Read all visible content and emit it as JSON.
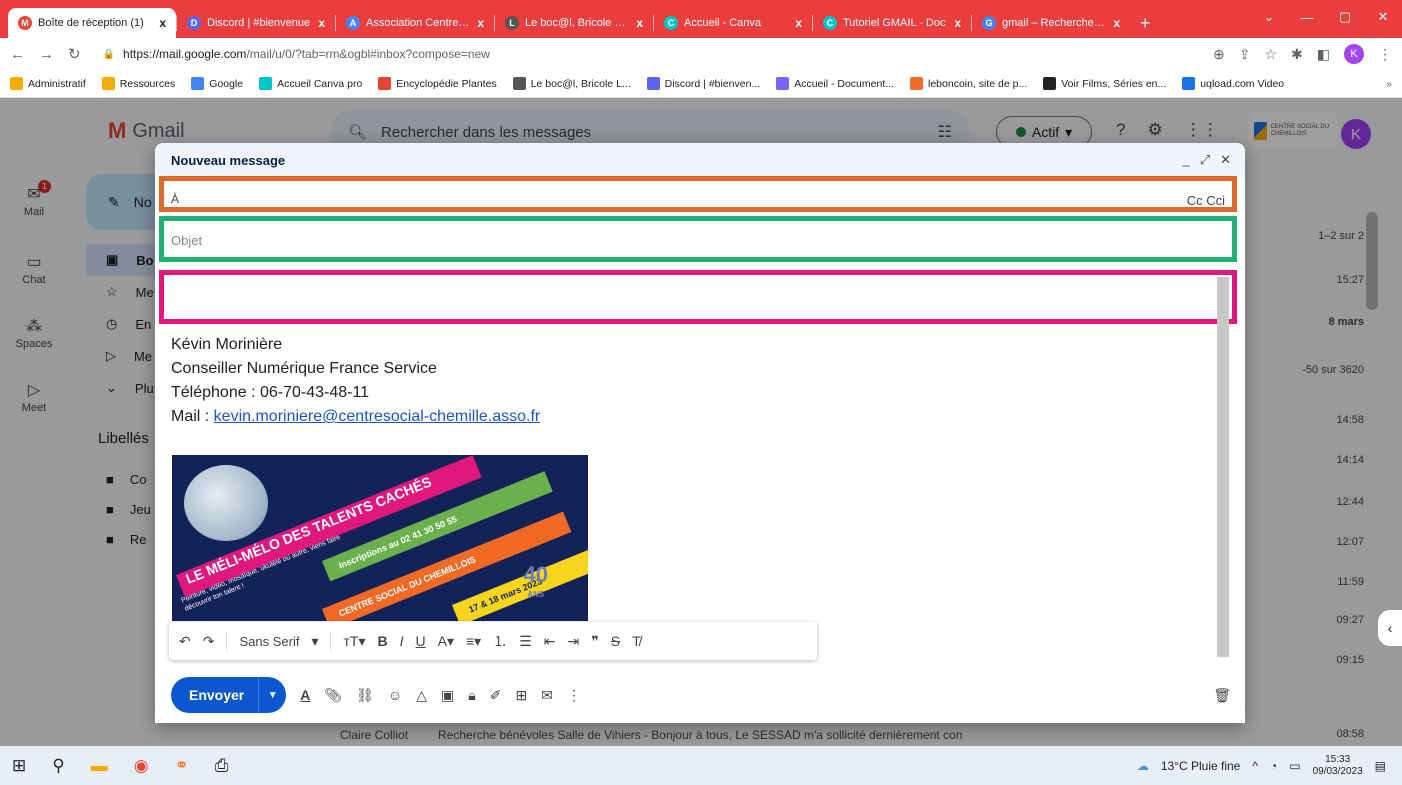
{
  "browser": {
    "tabs": [
      {
        "label": "Boîte de réception (1)",
        "color": "#ea4335",
        "glyph": "M",
        "active": true
      },
      {
        "label": "Discord | #bienvenue",
        "color": "#5865f2",
        "glyph": "D"
      },
      {
        "label": "Association Centre So",
        "color": "#4285f4",
        "glyph": "A"
      },
      {
        "label": "Le boc@l, Bricole Loc",
        "color": "#555555",
        "glyph": "L"
      },
      {
        "label": "Accueil - Canva",
        "color": "#00c4cc",
        "glyph": "C"
      },
      {
        "label": "Tutoriel GMAIL - Doc",
        "color": "#00c4cc",
        "glyph": "C"
      },
      {
        "label": "gmail – Recherche Go",
        "color": "#4285f4",
        "glyph": "G"
      }
    ],
    "tab_close": "x",
    "new_tab": "+",
    "window_controls": [
      "⌄",
      "—",
      "▢",
      "✕"
    ],
    "url_host": "https://mail.google.com",
    "url_rest": "/mail/u/0/?tab=rm&ogbl#inbox?compose=new",
    "profile_initial": "K",
    "bookmarks": [
      {
        "label": "Administratif",
        "color": "#f9ab00"
      },
      {
        "label": "Ressources",
        "color": "#f9ab00"
      },
      {
        "label": "Google",
        "color": "#4285f4"
      },
      {
        "label": "Accueil Canva pro",
        "color": "#00c4cc"
      },
      {
        "label": "Encyclopédie Plantes",
        "color": "#ea4335"
      },
      {
        "label": "Le boc@l, Bricole L...",
        "color": "#555555"
      },
      {
        "label": "Discord | #bienven...",
        "color": "#5865f2"
      },
      {
        "label": "Accueil - Document...",
        "color": "#7b61ff"
      },
      {
        "label": "leboncoin, site de p...",
        "color": "#f56b2a"
      },
      {
        "label": "Voir Films, Séries en...",
        "color": "#222222"
      },
      {
        "label": "uqload.com Video",
        "color": "#1a73e8"
      }
    ],
    "bookmarks_more": "»"
  },
  "gmail": {
    "logo_text": "Gmail",
    "search_placeholder": "Rechercher dans les messages",
    "status": "Actif",
    "org_name": "CENTRE SOCIAL DU CHEMILLOIS",
    "account_initial": "K",
    "rail": [
      {
        "label": "Mail",
        "icon": "mail-icon",
        "glyph": "✉",
        "badge": "1"
      },
      {
        "label": "Chat",
        "icon": "chat-icon",
        "glyph": "▭"
      },
      {
        "label": "Spaces",
        "icon": "spaces-icon",
        "glyph": "⁂"
      },
      {
        "label": "Meet",
        "icon": "meet-icon",
        "glyph": "▷"
      }
    ],
    "compose_label": "No",
    "nav": [
      {
        "label": "Bo",
        "glyph": "▣",
        "active": true
      },
      {
        "label": "Me",
        "glyph": "☆"
      },
      {
        "label": "En",
        "glyph": "◷"
      },
      {
        "label": "Me",
        "glyph": "▷"
      },
      {
        "label": "Plu",
        "glyph": "⌄"
      }
    ],
    "labels_heading": "Libellés",
    "labels": [
      "Co",
      "Jeu",
      "Re"
    ],
    "list_right": [
      {
        "text": "1–2 sur 2",
        "bold": false
      },
      {
        "text": "15:27",
        "bold": false
      },
      {
        "text": "8 mars",
        "bold": true
      },
      {
        "text": "-50 sur 3620",
        "bold": false
      },
      {
        "text": "14:58",
        "bold": false
      },
      {
        "text": "14:14",
        "bold": false
      },
      {
        "text": "12:44",
        "bold": false
      },
      {
        "text": "12:07",
        "bold": false
      },
      {
        "text": "11:59",
        "bold": false
      },
      {
        "text": "09:27",
        "bold": false
      },
      {
        "text": "09:15",
        "bold": false
      },
      {
        "text": "08:58",
        "bold": false
      }
    ],
    "bottom_sender": "Claire Colliot",
    "bottom_subject": "Recherche bénévoles Salle de Vihiers - Bonjour à tous, Le SESSAD m'a sollicité dernièrement con"
  },
  "compose": {
    "title": "Nouveau message",
    "header_controls": [
      "_",
      "⤢",
      "✕"
    ],
    "to_label": "À",
    "cc_label": "Cc Cci",
    "subject_placeholder": "Objet",
    "highlight_colors": {
      "to": "#e0682a",
      "subject": "#1fb172",
      "body": "#e0177c"
    },
    "signature": {
      "name": "Kévin Morinière",
      "role": "Conseiller Numérique France Service",
      "phone": "Téléphone : 06-70-43-48-11",
      "mail_prefix": "Mail : ",
      "mail": "kevin.moriniere@centresocial-chemille.asso.fr"
    },
    "poster": {
      "title": "LE MÉLI-MÉLO DES TALENTS CACHÉS",
      "subtitle": "Peinture, vidéo, mosaïque, ukulélé ou autre, viens faire découvrir ton talent !",
      "inscriptions": "Inscriptions au 02 41 30 50 55",
      "organizer": "CENTRE SOCIAL DU CHEMILLOIS",
      "dates": "17 & 18 mars 2023",
      "anniversary": "40",
      "anniversary_sub": "ANS"
    },
    "format_font": "Sans Serif",
    "send_label": "Envoyer"
  },
  "taskbar": {
    "weather": "13°C Pluie fine",
    "time": "15:33",
    "date": "09/03/2023"
  }
}
